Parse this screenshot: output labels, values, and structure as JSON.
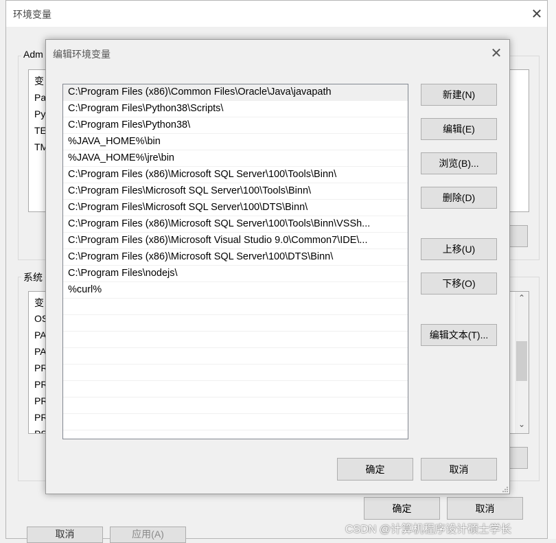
{
  "outer_dialog": {
    "title": "环境变量",
    "user_group_label": "Adm",
    "user_list_items": [
      "变",
      "Pa",
      "Py",
      "TE",
      "TM"
    ],
    "system_group_label": "系统",
    "system_list_items": [
      "变",
      "OS",
      "PA",
      "PA",
      "PR",
      "PR",
      "PR",
      "PR",
      "PS"
    ],
    "ok_label": "确定",
    "cancel_label": "取消",
    "hidden_bottom_buttons": [
      "取消",
      "应用(A)"
    ]
  },
  "edit_dialog": {
    "title": "编辑环境变量",
    "paths": [
      "C:\\Program Files (x86)\\Common Files\\Oracle\\Java\\javapath",
      "C:\\Program Files\\Python38\\Scripts\\",
      "C:\\Program Files\\Python38\\",
      "%JAVA_HOME%\\bin",
      "%JAVA_HOME%\\jre\\bin",
      "C:\\Program Files (x86)\\Microsoft SQL Server\\100\\Tools\\Binn\\",
      "C:\\Program Files\\Microsoft SQL Server\\100\\Tools\\Binn\\",
      "C:\\Program Files\\Microsoft SQL Server\\100\\DTS\\Binn\\",
      "C:\\Program Files (x86)\\Microsoft SQL Server\\100\\Tools\\Binn\\VSSh...",
      "C:\\Program Files (x86)\\Microsoft Visual Studio 9.0\\Common7\\IDE\\...",
      "C:\\Program Files (x86)\\Microsoft SQL Server\\100\\DTS\\Binn\\",
      "C:\\Program Files\\nodejs\\",
      "%curl%"
    ],
    "buttons": {
      "new": "新建(N)",
      "edit": "编辑(E)",
      "browse": "浏览(B)...",
      "delete": "删除(D)",
      "move_up": "上移(U)",
      "move_down": "下移(O)",
      "edit_text": "编辑文本(T)...",
      "ok": "确定",
      "cancel": "取消"
    }
  },
  "watermark": "CSDN @计算机程序设计硕士学长",
  "colors": {
    "dialog_bg": "#f0f0f0",
    "button_bg": "#e1e1e1",
    "button_border": "#adadad",
    "list_border": "#828790",
    "selected_row": "#efefef"
  },
  "icons": [
    "close-icon",
    "scroll-up-icon",
    "scroll-down-icon",
    "resize-grip-icon"
  ]
}
